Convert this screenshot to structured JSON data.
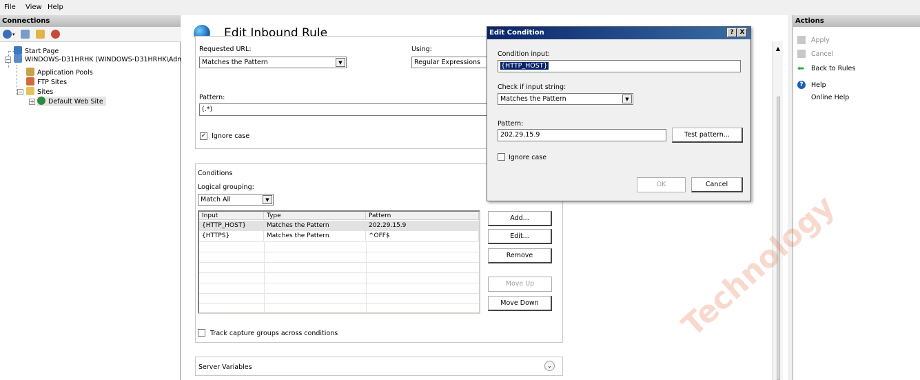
{
  "menu": [
    "File",
    "View",
    "Help"
  ],
  "connections": {
    "header": "Connections",
    "tree": {
      "start_page": "Start Page",
      "server": "WINDOWS-D31HRHK (WINDOWS-D31HRHK\\Admi",
      "app_pools": "Application Pools",
      "ftp_sites": "FTP Sites",
      "sites": "Sites",
      "default_site": "Default Web Site"
    }
  },
  "rule": {
    "title": "Edit Inbound Rule",
    "requested_url_label": "Requested URL:",
    "requested_url_value": "Matches the Pattern",
    "using_label": "Using:",
    "using_value": "Regular Expressions",
    "pattern_label": "Pattern:",
    "pattern_value": "(.*)",
    "ignore_case_label": "Ignore case",
    "ignore_case_checked": true
  },
  "conditions": {
    "title": "Conditions",
    "grouping_label": "Logical grouping:",
    "grouping_value": "Match All",
    "columns": [
      "Input",
      "Type",
      "Pattern"
    ],
    "rows": [
      {
        "input": "{HTTP_HOST}",
        "type": "Matches the Pattern",
        "pattern": "202.29.15.9"
      },
      {
        "input": "{HTTPS}",
        "type": "Matches the Pattern",
        "pattern": "^OFF$"
      }
    ],
    "buttons": {
      "add": "Add...",
      "edit": "Edit...",
      "remove": "Remove",
      "move_up": "Move Up",
      "move_down": "Move Down"
    },
    "track_label": "Track capture groups across conditions"
  },
  "server_variables": {
    "title": "Server Variables"
  },
  "actions": {
    "header": "Actions",
    "apply": "Apply",
    "cancel": "Cancel",
    "back": "Back to Rules",
    "help": "Help",
    "online_help": "Online Help"
  },
  "dialog": {
    "title": "Edit Condition",
    "help_btn": "?",
    "close_btn": "X",
    "condition_input_label": "Condition input:",
    "condition_input_value": "{HTTP_HOST}",
    "check_label": "Check if input string:",
    "check_value": "Matches the Pattern",
    "pattern_label": "Pattern:",
    "pattern_value": "202.29.15.9",
    "test_pattern": "Test pattern...",
    "ignore_case_label": "Ignore case",
    "ok": "OK",
    "cancel": "Cancel"
  },
  "watermark": "Technology"
}
